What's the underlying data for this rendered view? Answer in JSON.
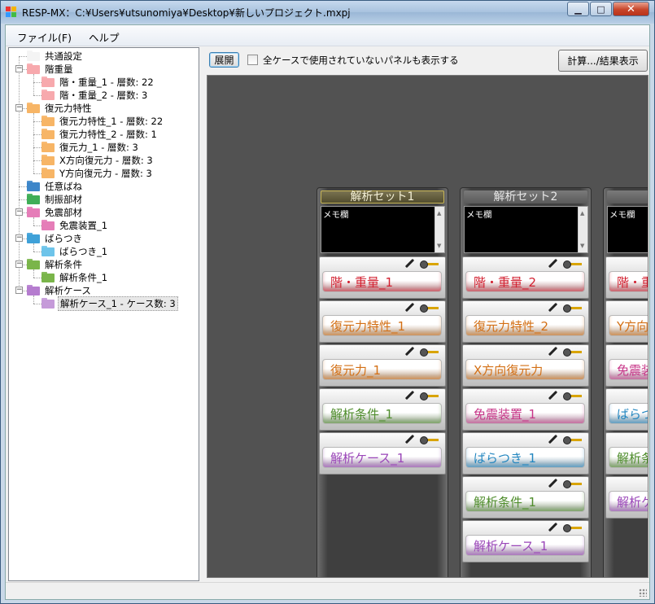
{
  "window": {
    "title": "RESP-MX：C:¥Users¥utsunomiya¥Desktop¥新しいプロジェクト.mxpj",
    "minimize": "▁",
    "maximize": "□",
    "close": "✕"
  },
  "menu": {
    "file": "ファイル(F)",
    "help": "ヘルプ"
  },
  "tree": {
    "nodes": [
      {
        "label": "共通設定",
        "color": "#f4f4f4"
      },
      {
        "label": "階重量",
        "color": "#f7a9ad"
      },
      {
        "label": "階・重量_1 - 層数: 22",
        "color": "#f7a9ad"
      },
      {
        "label": "階・重量_2 - 層数: 3",
        "color": "#f7a9ad"
      },
      {
        "label": "復元力特性",
        "color": "#f7b566"
      },
      {
        "label": "復元力特性_1 - 層数: 22",
        "color": "#f7b566"
      },
      {
        "label": "復元力特性_2 - 層数: 1",
        "color": "#f7b566"
      },
      {
        "label": "復元力_1 - 層数: 3",
        "color": "#f7b566"
      },
      {
        "label": "X方向復元力 - 層数: 3",
        "color": "#f7b566"
      },
      {
        "label": "Y方向復元力 - 層数: 3",
        "color": "#f7b566"
      },
      {
        "label": "任意ばね",
        "color": "#3d86c9"
      },
      {
        "label": "制振部材",
        "color": "#3fae57"
      },
      {
        "label": "免震部材",
        "color": "#e57db8"
      },
      {
        "label": "免震装置_1",
        "color": "#e57db8"
      },
      {
        "label": "ばらつき",
        "color": "#3fa1d8"
      },
      {
        "label": "ばらつき_1",
        "color": "#6ec4ea"
      },
      {
        "label": "解析条件",
        "color": "#7ab54a"
      },
      {
        "label": "解析条件_1",
        "color": "#7ab54a"
      },
      {
        "label": "解析ケース",
        "color": "#b57ccf"
      },
      {
        "label": "解析ケース_1 - ケース数: 3",
        "color": "#c59ad9"
      }
    ]
  },
  "toolbar": {
    "expand": "展開",
    "show_unused": "全ケースで使用されていないパネルも表示する",
    "calc": "計算.../結果表示"
  },
  "sets": [
    {
      "title": "解析セット1",
      "memo": "メモ欄",
      "cards": [
        {
          "label": "階・重量_1",
          "color": "#d21f2f"
        },
        {
          "label": "復元力特性_1",
          "color": "#d36f14"
        },
        {
          "label": "復元力_1",
          "color": "#d36f14"
        },
        {
          "label": "解析条件_1",
          "color": "#4f8d2c"
        },
        {
          "label": "解析ケース_1",
          "color": "#9a46b8"
        }
      ]
    },
    {
      "title": "解析セット2",
      "memo": "メモ欄",
      "cards": [
        {
          "label": "階・重量_2",
          "color": "#d21f2f"
        },
        {
          "label": "復元力特性_2",
          "color": "#d36f14"
        },
        {
          "label": "X方向復元力",
          "color": "#d36f14"
        },
        {
          "label": "免震装置_1",
          "color": "#c73588"
        },
        {
          "label": "ばらつき_1",
          "color": "#2185bf"
        },
        {
          "label": "解析条件_1",
          "color": "#4f8d2c"
        },
        {
          "label": "解析ケース_1",
          "color": "#9a46b8"
        }
      ]
    },
    {
      "title": "解析",
      "memo": "メモ欄",
      "cards": [
        {
          "label": "階・重",
          "color": "#d21f2f"
        },
        {
          "label": "Y方向",
          "color": "#d36f14"
        },
        {
          "label": "免震装",
          "color": "#c73588"
        },
        {
          "label": "ばらつ",
          "color": "#2185bf"
        },
        {
          "label": "解析条",
          "color": "#4f8d2c"
        },
        {
          "label": "解析ケ",
          "color": "#9a46b8"
        }
      ]
    }
  ]
}
